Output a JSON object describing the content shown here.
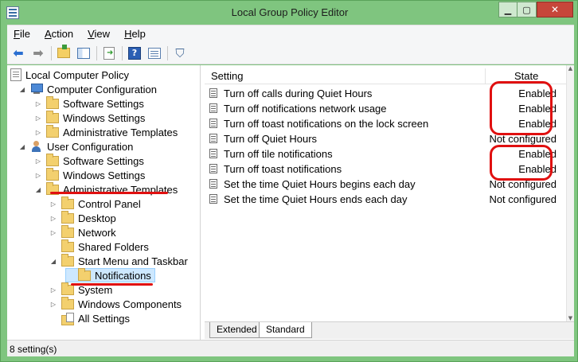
{
  "window": {
    "title": "Local Group Policy Editor",
    "minimize": "▁",
    "maximize": "▢",
    "close": "✕"
  },
  "menu": [
    "File",
    "Action",
    "View",
    "Help"
  ],
  "toolbar": {
    "icons": [
      "back-arrow-icon",
      "forward-arrow-icon",
      "up-folder-icon",
      "show-hide-tree-icon",
      "export-list-icon",
      "help-icon",
      "properties-icon",
      "filter-icon"
    ]
  },
  "tree": [
    {
      "label": "Local Computer Policy",
      "level": 0,
      "expander": "none",
      "icon": "document-icon"
    },
    {
      "label": "Computer Configuration",
      "level": 1,
      "expander": "expanded",
      "icon": "computer-icon"
    },
    {
      "label": "Software Settings",
      "level": 2,
      "expander": "collapsed",
      "icon": "folder-icon"
    },
    {
      "label": "Windows Settings",
      "level": 2,
      "expander": "collapsed",
      "icon": "folder-icon"
    },
    {
      "label": "Administrative Templates",
      "level": 2,
      "expander": "collapsed",
      "icon": "folder-icon"
    },
    {
      "label": "User Configuration",
      "level": 1,
      "expander": "expanded",
      "icon": "user-icon"
    },
    {
      "label": "Software Settings",
      "level": 2,
      "expander": "collapsed",
      "icon": "folder-icon"
    },
    {
      "label": "Windows Settings",
      "level": 2,
      "expander": "collapsed",
      "icon": "folder-icon"
    },
    {
      "label": "Administrative Templates",
      "level": 2,
      "expander": "expanded",
      "icon": "folder-icon"
    },
    {
      "label": "Control Panel",
      "level": 3,
      "expander": "collapsed",
      "icon": "folder-icon"
    },
    {
      "label": "Desktop",
      "level": 3,
      "expander": "collapsed",
      "icon": "folder-icon"
    },
    {
      "label": "Network",
      "level": 3,
      "expander": "collapsed",
      "icon": "folder-icon"
    },
    {
      "label": "Shared Folders",
      "level": 3,
      "expander": "none",
      "icon": "folder-icon"
    },
    {
      "label": "Start Menu and Taskbar",
      "level": 3,
      "expander": "expanded",
      "icon": "folder-icon"
    },
    {
      "label": "Notifications",
      "level": 4,
      "expander": "none",
      "icon": "folder-icon",
      "selected": true
    },
    {
      "label": "System",
      "level": 3,
      "expander": "collapsed",
      "icon": "folder-icon"
    },
    {
      "label": "Windows Components",
      "level": 3,
      "expander": "collapsed",
      "icon": "folder-icon"
    },
    {
      "label": "All Settings",
      "level": 3,
      "expander": "none",
      "icon": "all-settings-icon"
    }
  ],
  "list": {
    "columns": {
      "setting": "Setting",
      "state": "State"
    },
    "rows": [
      {
        "setting": "Turn off calls during Quiet Hours",
        "state": "Enabled"
      },
      {
        "setting": "Turn off notifications network usage",
        "state": "Enabled"
      },
      {
        "setting": "Turn off toast notifications on the lock screen",
        "state": "Enabled"
      },
      {
        "setting": "Turn off Quiet Hours",
        "state": "Not configured"
      },
      {
        "setting": "Turn off tile notifications",
        "state": "Enabled"
      },
      {
        "setting": "Turn off toast notifications",
        "state": "Enabled"
      },
      {
        "setting": "Set the time Quiet Hours begins each day",
        "state": "Not configured"
      },
      {
        "setting": "Set the time Quiet Hours ends each day",
        "state": "Not configured"
      }
    ]
  },
  "tabs": {
    "extended": "Extended",
    "standard": "Standard",
    "active": "Standard"
  },
  "status": {
    "text": "8 setting(s)"
  },
  "colors": {
    "titlebar": "#7fc57f",
    "annotation": "#e01010",
    "selection": "#cde8ff",
    "close_button": "#c7463a"
  }
}
